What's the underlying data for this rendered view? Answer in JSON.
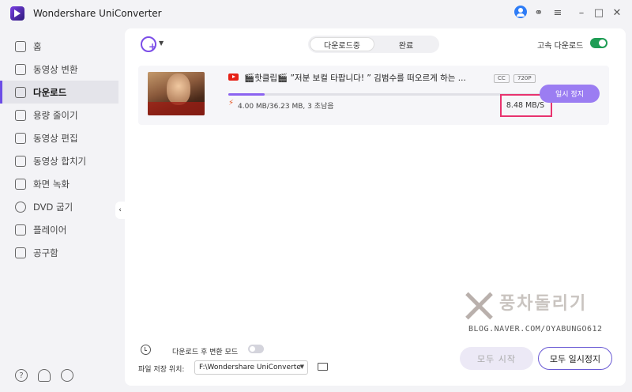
{
  "window": {
    "title": "Wondershare UniConverter"
  },
  "sidebar": {
    "items": [
      {
        "label": "홈",
        "icon": "home-icon"
      },
      {
        "label": "동영상 변환",
        "icon": "convert-icon"
      },
      {
        "label": "다운로드",
        "icon": "download-icon",
        "active": true
      },
      {
        "label": "용량 줄이기",
        "icon": "compress-icon"
      },
      {
        "label": "동영상 편집",
        "icon": "scissors-icon"
      },
      {
        "label": "동영상 합치기",
        "icon": "merge-icon"
      },
      {
        "label": "화면 녹화",
        "icon": "record-icon"
      },
      {
        "label": "DVD 굽기",
        "icon": "disc-icon"
      },
      {
        "label": "플레이어",
        "icon": "player-icon"
      },
      {
        "label": "공구함",
        "icon": "toolbox-icon"
      }
    ],
    "bottom_icons": [
      "help-icon",
      "bell-icon",
      "feedback-icon"
    ]
  },
  "main": {
    "tabs": [
      {
        "label": "다운로드중",
        "active": true
      },
      {
        "label": "완료",
        "active": false
      }
    ],
    "high_speed_label": "고속 다운로드",
    "high_speed_enabled": true
  },
  "download": {
    "title": "🎬핫클립🎬 ”저분 보컬 타팝니다! ” 김범수를 떠오르게 하는 ...",
    "badge_cc": "CC",
    "badge_quality": "720P",
    "progress_fraction": 0.11,
    "size_text": "4.00 MB/36.23 MB, 3 초남음",
    "speed": "8.48 MB/S",
    "pause_label": "일시 정지"
  },
  "footer": {
    "convert_after_label": "다운로드 후 변환 모드",
    "convert_after_enabled": false,
    "save_path_label": "파일 저장 위치:",
    "save_path_value": "F:\\Wondershare UniConverte",
    "start_all_label": "모두 시작",
    "pause_all_label": "모두 일시정지"
  },
  "watermark": {
    "text": "풍차돌리기",
    "url": "BLOG.NAVER.COM/OYABUNGO612"
  },
  "colors": {
    "accent": "#8b63f0",
    "toggle_on": "#1f9d55",
    "highlight_box": "#e8336f"
  }
}
